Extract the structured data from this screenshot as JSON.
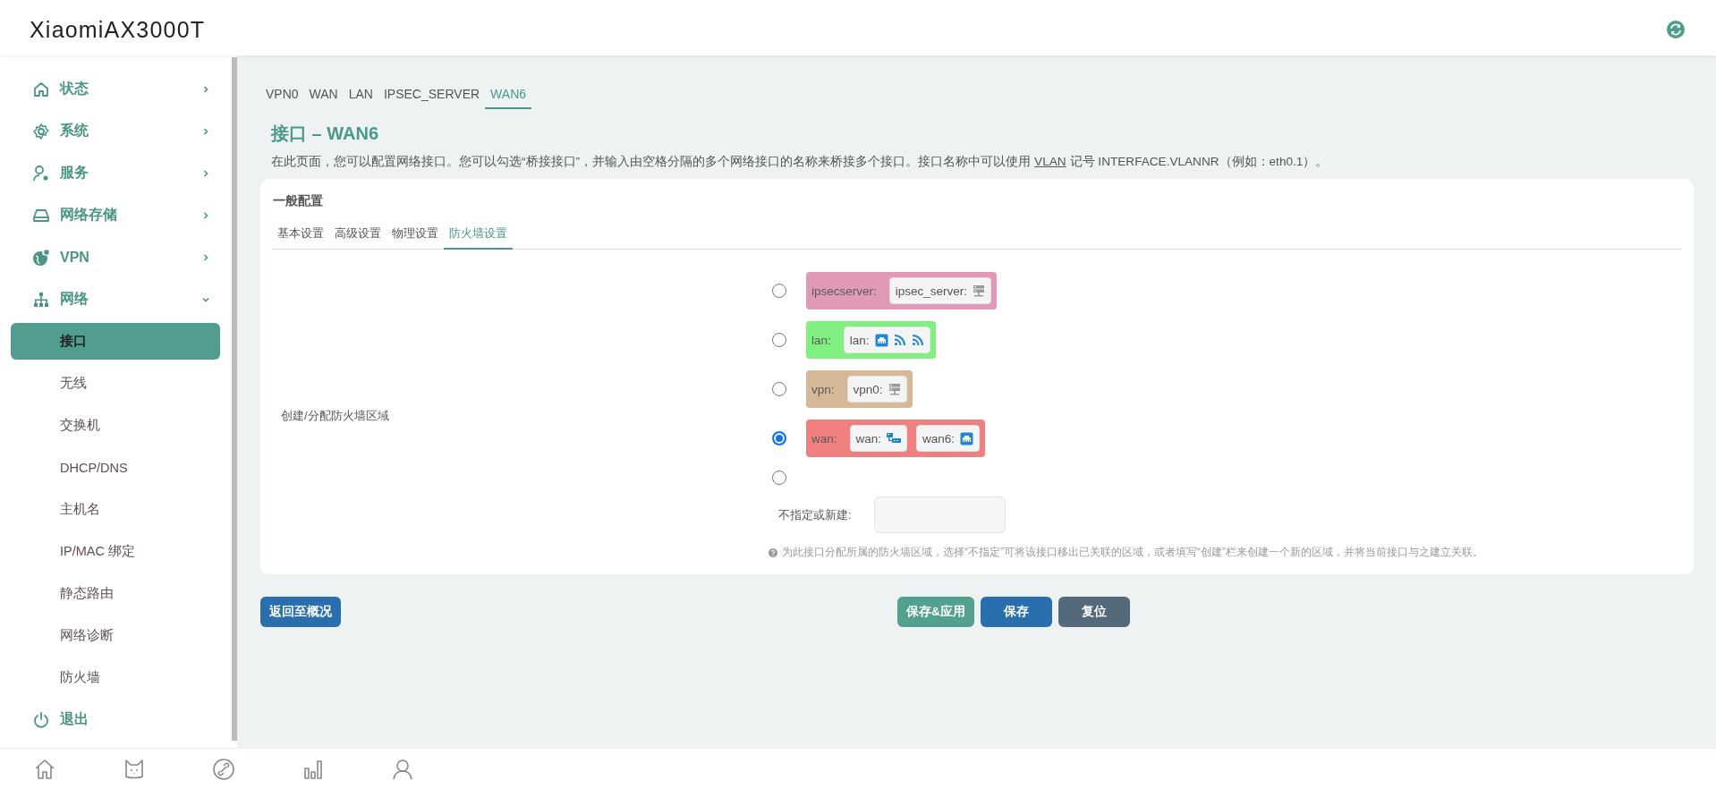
{
  "header": {
    "title": "XiaomiAX3000T"
  },
  "sidebar": {
    "items": [
      {
        "kind": "group",
        "label": "状态",
        "expanded": false
      },
      {
        "kind": "group",
        "label": "系统",
        "expanded": false
      },
      {
        "kind": "group",
        "label": "服务",
        "expanded": false
      },
      {
        "kind": "group",
        "label": "网络存储",
        "expanded": false
      },
      {
        "kind": "group",
        "label": "VPN",
        "expanded": false
      },
      {
        "kind": "group",
        "label": "网络",
        "expanded": true,
        "children": [
          {
            "label": "接口",
            "selected": true
          },
          {
            "label": "无线",
            "selected": false
          },
          {
            "label": "交换机",
            "selected": false
          },
          {
            "label": "DHCP/DNS",
            "selected": false
          },
          {
            "label": "主机名",
            "selected": false
          },
          {
            "label": "IP/MAC 绑定",
            "selected": false
          },
          {
            "label": "静态路由",
            "selected": false
          },
          {
            "label": "网络诊断",
            "selected": false
          },
          {
            "label": "防火墙",
            "selected": false
          }
        ]
      },
      {
        "kind": "action",
        "label": "退出"
      }
    ]
  },
  "page": {
    "tabs": [
      {
        "label": "VPN0",
        "selected": false
      },
      {
        "label": "WAN",
        "selected": false
      },
      {
        "label": "LAN",
        "selected": false
      },
      {
        "label": "IPSEC_SERVER",
        "selected": false
      },
      {
        "label": "WAN6",
        "selected": true
      }
    ],
    "title": "接口 – WAN6",
    "description": {
      "before": "在此页面，您可以配置网络接口。您可以勾选“桥接接口”，并输入由空格分隔的多个网络接口的名称来桥接多个接口。接口名称中可以使用",
      "link": "VLAN",
      "after": "记号 INTERFACE.VLANNR（例如：eth0.1）。"
    },
    "section": {
      "title": "一般配置",
      "tabs": [
        {
          "label": "基本设置",
          "selected": false
        },
        {
          "label": "高级设置",
          "selected": false
        },
        {
          "label": "物理设置",
          "selected": false
        },
        {
          "label": "防火墙设置",
          "selected": true
        }
      ],
      "field": {
        "label": "创建/分配防火墙区域",
        "zones": [
          {
            "name": "ipsecserver:",
            "color": "#e09ab6",
            "selected": false,
            "members": [
              {
                "label": "ipsec_server:",
                "devices": [
                  {
                    "kind": "server"
                  }
                ]
              }
            ]
          },
          {
            "name": "lan:",
            "color": "#80f080",
            "selected": false,
            "members": [
              {
                "label": "lan:",
                "devices": [
                  {
                    "kind": "ethernet"
                  },
                  {
                    "kind": "wireless"
                  },
                  {
                    "kind": "wireless"
                  }
                ]
              }
            ]
          },
          {
            "name": "vpn:",
            "color": "#d4b898",
            "selected": false,
            "members": [
              {
                "label": "vpn0:",
                "devices": [
                  {
                    "kind": "server"
                  }
                ]
              }
            ]
          },
          {
            "name": "wan:",
            "color": "#f08080",
            "selected": true,
            "members": [
              {
                "label": "wan:",
                "devices": [
                  {
                    "kind": "switch"
                  }
                ]
              },
              {
                "label": "wan6:",
                "devices": [
                  {
                    "kind": "ethernet"
                  }
                ]
              }
            ]
          }
        ],
        "new_zone": {
          "selected": false,
          "label": "不指定或新建:"
        },
        "help": "为此接口分配所属的防火墙区域，选择“不指定”可将该接口移出已关联的区域，或者填写“创建”栏来创建一个新的区域，并将当前接口与之建立关联。"
      }
    },
    "back_button": "返回至概况",
    "actions": [
      {
        "kind": "apply",
        "label": "保存&应用"
      },
      {
        "kind": "save",
        "label": "保存"
      },
      {
        "kind": "reset",
        "label": "复位"
      }
    ]
  }
}
